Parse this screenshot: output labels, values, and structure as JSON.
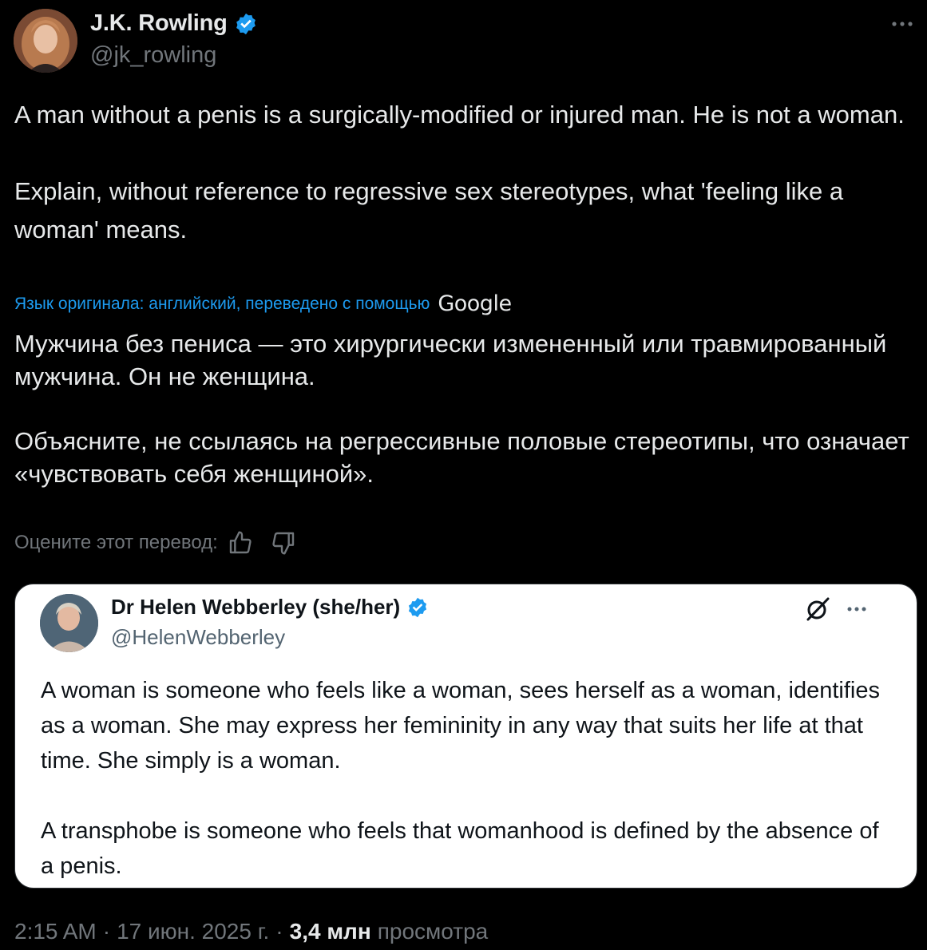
{
  "author": {
    "name": "J.K. Rowling",
    "handle": "@jk_rowling"
  },
  "tweet": {
    "paragraphs": [
      "A man without a penis is a surgically-modified or injured man. He is not a woman.",
      "Explain, without reference to regressive sex stereotypes, what 'feeling like a woman' means."
    ]
  },
  "translation": {
    "label": "Язык оригинала: английский, переведено с помощью",
    "provider": "Google",
    "paragraphs": [
      "Мужчина без пениса — это хирургически измененный или травмированный мужчина. Он не женщина.",
      "Объясните, не ссылаясь на регрессивные половые стереотипы, что означает «чувствовать себя женщиной»."
    ],
    "rate_label": "Оцените этот перевод:"
  },
  "quote": {
    "name": "Dr Helen Webberley (she/her)",
    "handle": "@HelenWebberley",
    "paragraphs": [
      "A woman is someone who feels like a woman, sees herself as a woman, identifies as a woman. She may express her femininity in any way that suits her life at that time. She simply is a woman.",
      "A transphobe is someone who feels that womanhood is defined by the absence of a penis."
    ]
  },
  "meta": {
    "time": "2:15 AM",
    "separator": "·",
    "date": "17 июн. 2025 г.",
    "views_count": "3,4 млн",
    "views_label": "просмотра"
  },
  "colors": {
    "background": "#000000",
    "text": "#e7e9ea",
    "secondary": "#71767b",
    "accent": "#1d9bf0"
  },
  "icons": {
    "verified": "verified-badge-icon",
    "more": "more-horizontal-icon",
    "thumbs_up": "thumbs-up-icon",
    "thumbs_down": "thumbs-down-icon",
    "grok": "grok-icon"
  }
}
